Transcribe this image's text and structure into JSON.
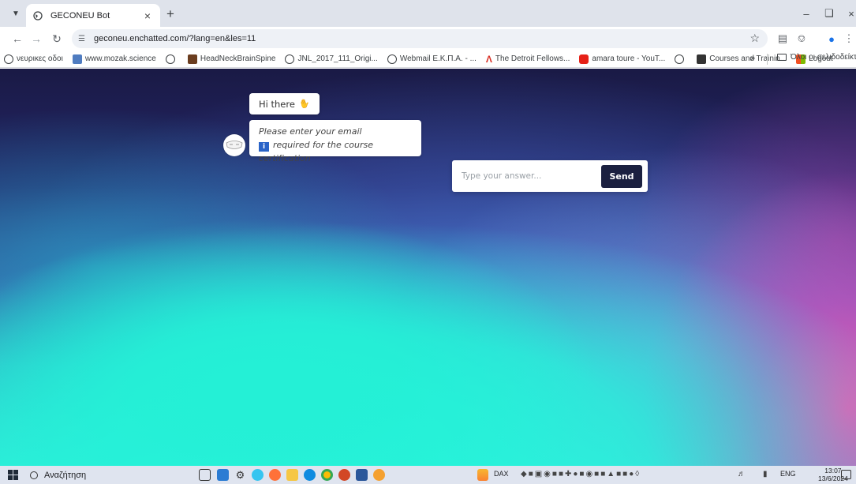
{
  "browser": {
    "tab_title": "GECONEU Bot",
    "url": "geconeu.enchatted.com/?lang=en&les=11",
    "bookmarks": [
      {
        "label": "νευρικες οδοι",
        "icon": "globe-icon"
      },
      {
        "label": "www.mozak.science",
        "icon": "mozak-icon"
      },
      {
        "label": "",
        "icon": "globe-icon"
      },
      {
        "label": "HeadNeckBrainSpine",
        "icon": "book-icon"
      },
      {
        "label": "JNL_2017_111_Origi...",
        "icon": "globe-icon"
      },
      {
        "label": "Webmail Ε.Κ.Π.Α. - ...",
        "icon": "globe-icon"
      },
      {
        "label": "The Detroit Fellows...",
        "icon": "detroit-icon"
      },
      {
        "label": "amara toure - YouT...",
        "icon": "youtube-icon"
      },
      {
        "label": "",
        "icon": "globe-icon"
      },
      {
        "label": "Courses and Trainin...",
        "icon": "courses-icon"
      },
      {
        "label": "Logout",
        "icon": "microsoft-icon"
      }
    ],
    "bookmarks_more": "»",
    "other_bookmarks": "Όλοι οι σελιδοδείκτες"
  },
  "chat": {
    "greeting": "Hi there",
    "prompt_line1": "Please enter your email",
    "prompt_info": "i",
    "prompt_line2": "required for the course certification",
    "answer_placeholder": "Type your answer...",
    "send_label": "Send"
  },
  "taskbar": {
    "search_placeholder": "Αναζήτηση",
    "dax_label": "DAX",
    "language": "ENG",
    "time": "13:07",
    "date": "13/6/2024"
  },
  "colors": {
    "send_button": "#1b2040",
    "info_badge": "#2a64c8",
    "page_top": "#1a1a45",
    "page_bottom": "#2de9d6",
    "page_accent": "#ee52b2"
  }
}
